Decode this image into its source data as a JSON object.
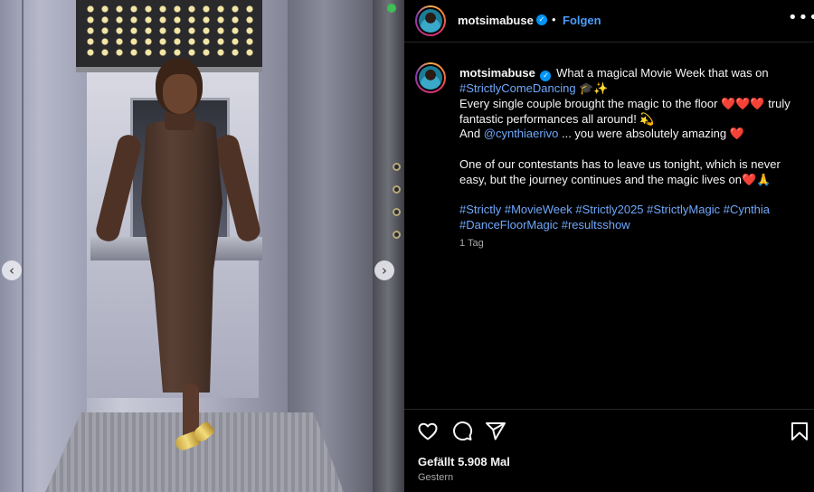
{
  "post": {
    "media": {
      "prev_label": "‹",
      "next_label": "›"
    },
    "header": {
      "username": "motsimabuse",
      "verified": "✓",
      "separator": "•",
      "follow_label": "Folgen",
      "more_label": "•••"
    },
    "caption": {
      "username": "motsimabuse",
      "verified": "✓",
      "line1_text": "What a magical Movie Week that was on",
      "hashtag_strictly_come_dancing": "#StrictlyComeDancing",
      "line1_emoji": "🎓✨",
      "line2_text": "Every single couple brought the magic to the floor ❤️❤️❤️ truly fantastic performances all around! 💫",
      "line3_prefix": "And",
      "mention": "@cynthiaerivo",
      "line3_suffix": "... you were absolutely amazing ❤️",
      "line4_text": "One of our contestants has to leave us tonight, which is never easy, but the journey continues and the magic lives on❤️🙏",
      "hashtags": [
        "#Strictly",
        "#MovieWeek",
        "#Strictly2025",
        "#StrictlyMagic",
        "#Cynthia",
        "#DanceFloorMagic",
        "#resultsshow"
      ],
      "time_ago": "1 Tag"
    },
    "footer": {
      "likes_text": "Gefällt 5.908 Mal",
      "date_text": "Gestern"
    },
    "icons": {
      "like": "heart-icon",
      "comment": "comment-icon",
      "share": "share-icon",
      "save": "bookmark-icon"
    },
    "colors": {
      "background": "#000000",
      "link": "#6fa8fb",
      "follow": "#4a9dfb",
      "verified": "#0095f6",
      "secondary_text": "#a8a8a8"
    }
  }
}
